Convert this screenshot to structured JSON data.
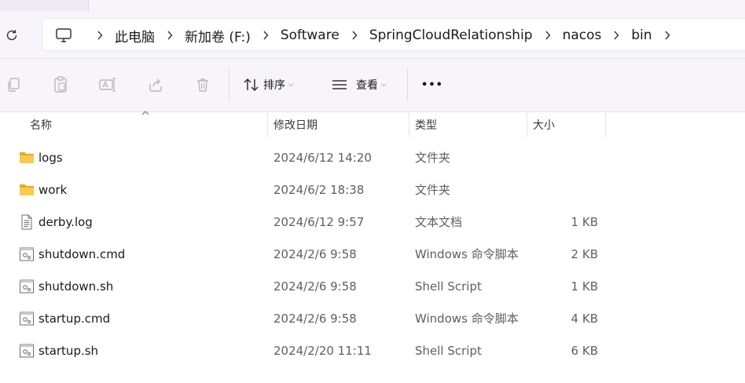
{
  "breadcrumb": [
    "此电脑",
    "新加卷 (F:)",
    "Software",
    "SpringCloudRelationship",
    "nacos",
    "bin"
  ],
  "toolbar": {
    "sort_label": "排序",
    "view_label": "查看",
    "more_label": "•••"
  },
  "columns": {
    "name": "名称",
    "date": "修改日期",
    "type": "类型",
    "size": "大小"
  },
  "files": [
    {
      "name": "logs",
      "date": "2024/6/12 14:20",
      "type": "文件夹",
      "size": "",
      "icon": "folder-icon"
    },
    {
      "name": "work",
      "date": "2024/6/2 18:38",
      "type": "文件夹",
      "size": "",
      "icon": "folder-icon"
    },
    {
      "name": "derby.log",
      "date": "2024/6/12 9:57",
      "type": "文本文档",
      "size": "1 KB",
      "icon": "text-file-icon"
    },
    {
      "name": "shutdown.cmd",
      "date": "2024/2/6 9:58",
      "type": "Windows 命令脚本",
      "size": "2 KB",
      "icon": "script-file-icon"
    },
    {
      "name": "shutdown.sh",
      "date": "2024/2/6 9:58",
      "type": "Shell Script",
      "size": "1 KB",
      "icon": "script-file-icon"
    },
    {
      "name": "startup.cmd",
      "date": "2024/2/6 9:58",
      "type": "Windows 命令脚本",
      "size": "4 KB",
      "icon": "script-file-icon"
    },
    {
      "name": "startup.sh",
      "date": "2024/2/20 11:11",
      "type": "Shell Script",
      "size": "6 KB",
      "icon": "script-file-icon"
    }
  ],
  "colors": {
    "folder": "#f5c342",
    "chrome": "#f7f5fa",
    "accent": "#005fb8"
  }
}
